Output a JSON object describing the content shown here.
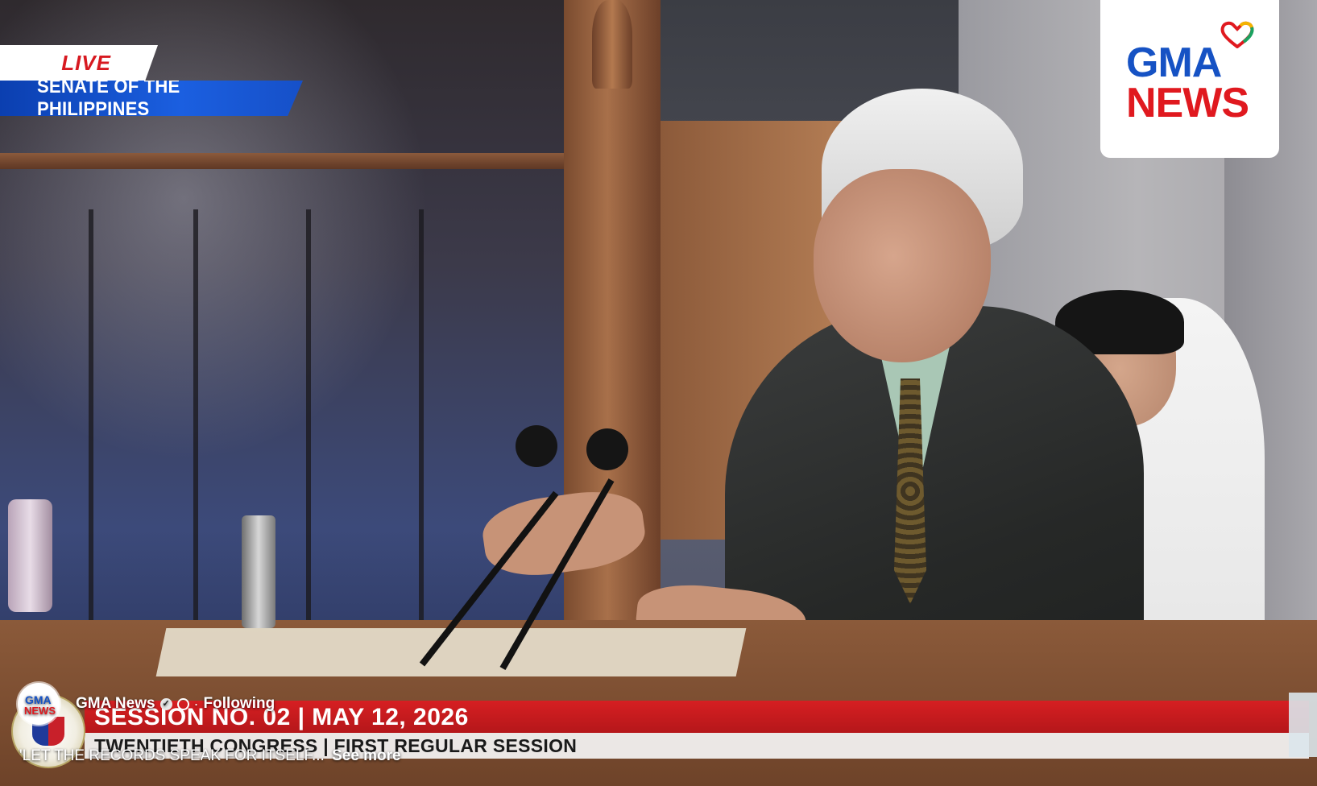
{
  "broadcast": {
    "live_label": "LIVE",
    "venue_label": "SENATE OF THE PHILIPPINES"
  },
  "logo": {
    "line1": "GMA",
    "line2": "NEWS"
  },
  "lower_third": {
    "session": "SESSION NO. 02 | MAY 12, 2026",
    "congress": "TWENTIETH CONGRESS | FIRST REGULAR SESSION"
  },
  "post": {
    "channel_name": "GMA News",
    "avatar_line1": "GMA",
    "avatar_line2": "NEWS",
    "separator": "·",
    "follow_status": "Following",
    "caption": "'LET THE RECORDS SPEAK FOR ITSELF...",
    "see_more": "See more"
  },
  "colors": {
    "live_red": "#d71920",
    "senate_blue": "#1b5fe0",
    "gma_blue": "#1652c4",
    "gma_red": "#e0191f",
    "lower_bar_red": "#c81b1e"
  }
}
